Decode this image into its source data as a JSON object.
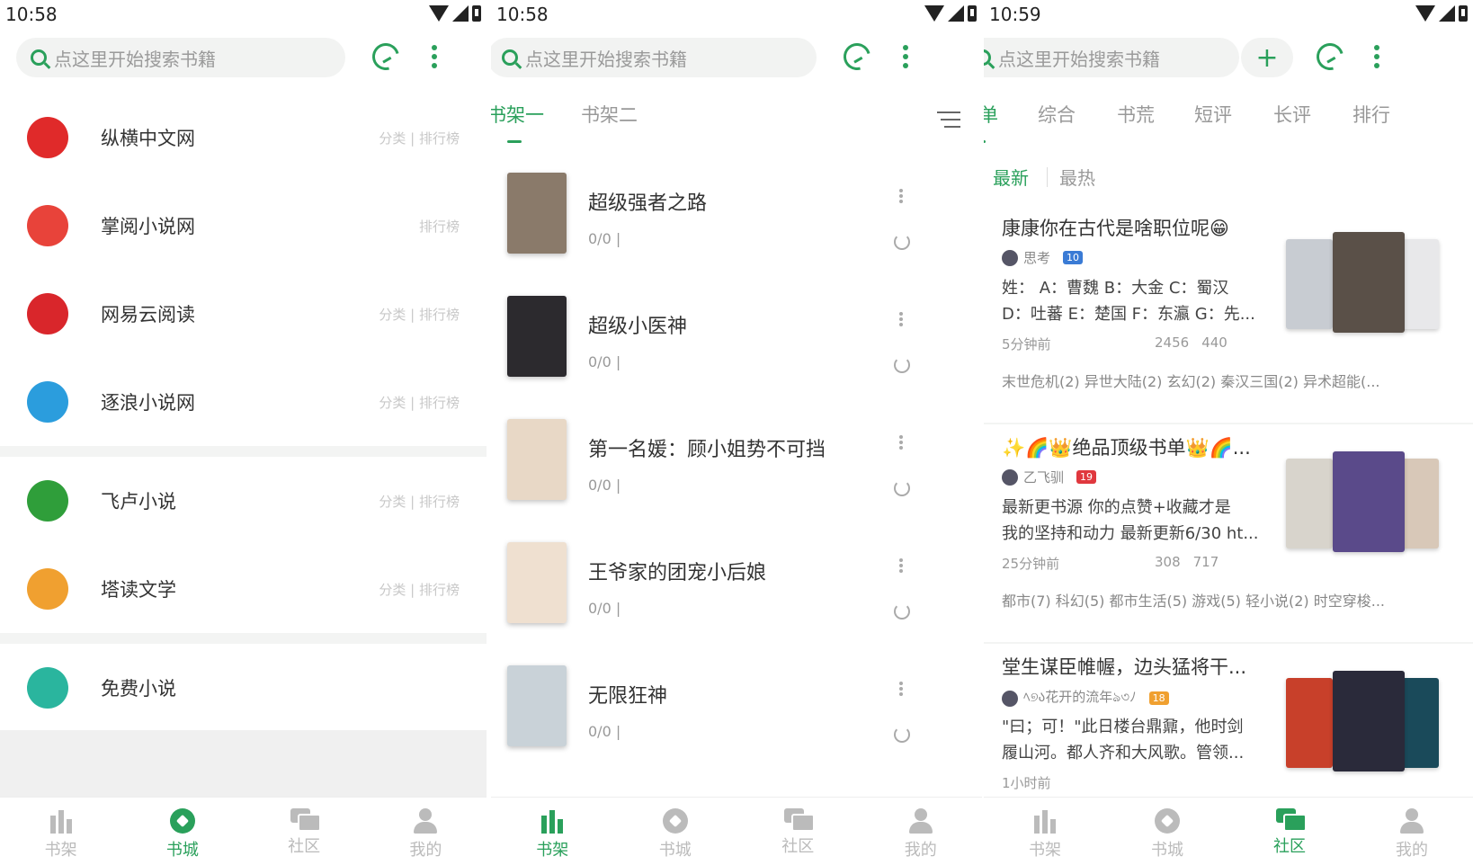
{
  "colors": {
    "accent": "#2aa05b",
    "text": "#333333",
    "muted": "#999999"
  },
  "screen1": {
    "time": "10:58",
    "search_placeholder": "点这里开始搜索书籍",
    "sources": [
      {
        "name": "纵横中文网",
        "links": "分类 | 排行榜",
        "icon": "zongheng-logo-icon",
        "color": "#e02a2a"
      },
      {
        "name": "掌阅小说网",
        "links": "排行榜",
        "icon": "zhangyue-logo-icon",
        "color": "#e8433a"
      },
      {
        "name": "网易云阅读",
        "links": "分类 | 排行榜",
        "icon": "netease-logo-icon",
        "color": "#d9262b"
      },
      {
        "name": "逐浪小说网",
        "links": "分类 | 排行榜",
        "icon": "zhulang-logo-icon",
        "color": "#2b9ddd"
      },
      {
        "name": "飞卢小说",
        "links": "分类 | 排行榜",
        "icon": "feilu-logo-icon",
        "color": "#2f9e3a"
      },
      {
        "name": "塔读文学",
        "links": "分类 | 排行榜",
        "icon": "tadu-logo-icon",
        "color": "#f0a030"
      },
      {
        "name": "免费小说",
        "links": "",
        "icon": "eye-icon",
        "color": "#2ab59e"
      }
    ],
    "nav": [
      "书架",
      "书城",
      "社区",
      "我的"
    ],
    "nav_active": 1
  },
  "screen2": {
    "time": "10:58",
    "search_placeholder": "点这里开始搜索书籍",
    "tabs": [
      "书架一",
      "书架二"
    ],
    "books": [
      {
        "title": "超级强者之路",
        "progress": "0/0 |",
        "cover": "#8a7a6a"
      },
      {
        "title": "超级小医神",
        "progress": "0/0 |",
        "cover": "#2c2a2e"
      },
      {
        "title": "第一名媛：顾小姐势不可挡",
        "progress": "0/0 |",
        "cover": "#e8d8c6"
      },
      {
        "title": "王爷家的团宠小后娘",
        "progress": "0/0 |",
        "cover": "#efe0d0"
      },
      {
        "title": "无限狂神",
        "progress": "0/0 |",
        "cover": "#c9d2d8"
      }
    ],
    "nav": [
      "书架",
      "书城",
      "社区",
      "我的"
    ],
    "nav_active": 0
  },
  "screen3": {
    "time": "10:59",
    "search_placeholder": "点这里开始搜索书籍",
    "add_label": "+",
    "tabs": [
      "书单",
      "综合",
      "书荒",
      "短评",
      "长评",
      "排行"
    ],
    "subtabs": [
      "最新",
      "最热"
    ],
    "posts": [
      {
        "title": "康康你在古代是啥职位呢😁",
        "author": "思考",
        "level": "10",
        "level_color": "#3a7bd5",
        "body1": "姓： A：曹魏 B：大金 C：蜀汉",
        "body2": "D：吐蕃 E：楚国 F：东瀛 G：先...",
        "time": "5分钟前",
        "comments": "2456",
        "likes": "440",
        "tags": "末世危机(2) 异世大陆(2) 玄幻(2) 秦汉三国(2) 异术超能(...",
        "covers": [
          "#c8ccd2",
          "#5a5048",
          "#e8e8ea"
        ]
      },
      {
        "title": "✨🌈👑绝品顶级书单👑🌈...",
        "author": "乙飞驯",
        "level": "19",
        "level_color": "#e0383e",
        "body1": "最新更书源 你的点赞+收藏才是",
        "body2": "我的坚持和动力 最新更新6/30 ht...",
        "time": "25分钟前",
        "comments": "308",
        "likes": "717",
        "tags": "都市(7) 科幻(5) 都市生活(5) 游戏(5) 轻小说(2) 时空穿梭...",
        "covers": [
          "#d8d4cc",
          "#5a4a8a",
          "#d8c8b8"
        ]
      },
      {
        "title": "堂生谋臣帷幄，边头猛将干...",
        "author": "ﾍ୭ა花开的流年ঌ৩ﾉ",
        "level": "18",
        "level_color": "#f0a030",
        "body1": "\"曰；可！\"此日楼台鼎鼐，他时剑",
        "body2": "履山河。都人齐和大风歌。管领...",
        "time": "1小时前",
        "comments": "",
        "likes": "",
        "tags": "",
        "covers": [
          "#c8402a",
          "#2a2a3a",
          "#1a4a5a"
        ]
      }
    ],
    "nav": [
      "书架",
      "书城",
      "社区",
      "我的"
    ],
    "nav_active": 2
  }
}
